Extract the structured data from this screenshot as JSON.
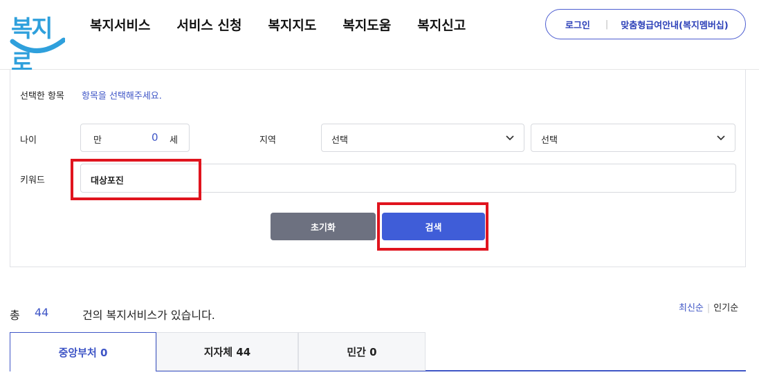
{
  "header": {
    "logo_text": "복지로",
    "nav": [
      "복지서비스",
      "서비스 신청",
      "복지지도",
      "복지도움",
      "복지신고"
    ],
    "login_label": "로그인",
    "divider": "|",
    "membership_label": "맞춤형급여안내(복지멤버십)"
  },
  "filter": {
    "selected_label": "선택한 항목",
    "selected_hint": "항목을 선택해주세요.",
    "age_label": "나이",
    "age_prefix": "만",
    "age_value": "0",
    "age_suffix": "세",
    "region_label": "지역",
    "region_select_1": "선택",
    "region_select_2": "선택",
    "keyword_label": "키워드",
    "keyword_value": "대상포진",
    "reset_label": "초기화",
    "search_label": "검색"
  },
  "results": {
    "total_prefix": "총",
    "total_count": "44",
    "total_suffix": "건의 복지서비스가 있습니다.",
    "sort_latest": "최신순",
    "sort_divider": "|",
    "sort_popular": "인기순",
    "tabs": [
      {
        "label": "중앙부처 0",
        "active": true
      },
      {
        "label": "지자체 44",
        "active": false
      },
      {
        "label": "민간 0",
        "active": false
      }
    ]
  },
  "colors": {
    "accent": "#3e55c6",
    "logo": "#2fa0dc",
    "highlight": "#e0141e",
    "reset_button": "#6d7180",
    "search_button": "#3f5dd8"
  }
}
